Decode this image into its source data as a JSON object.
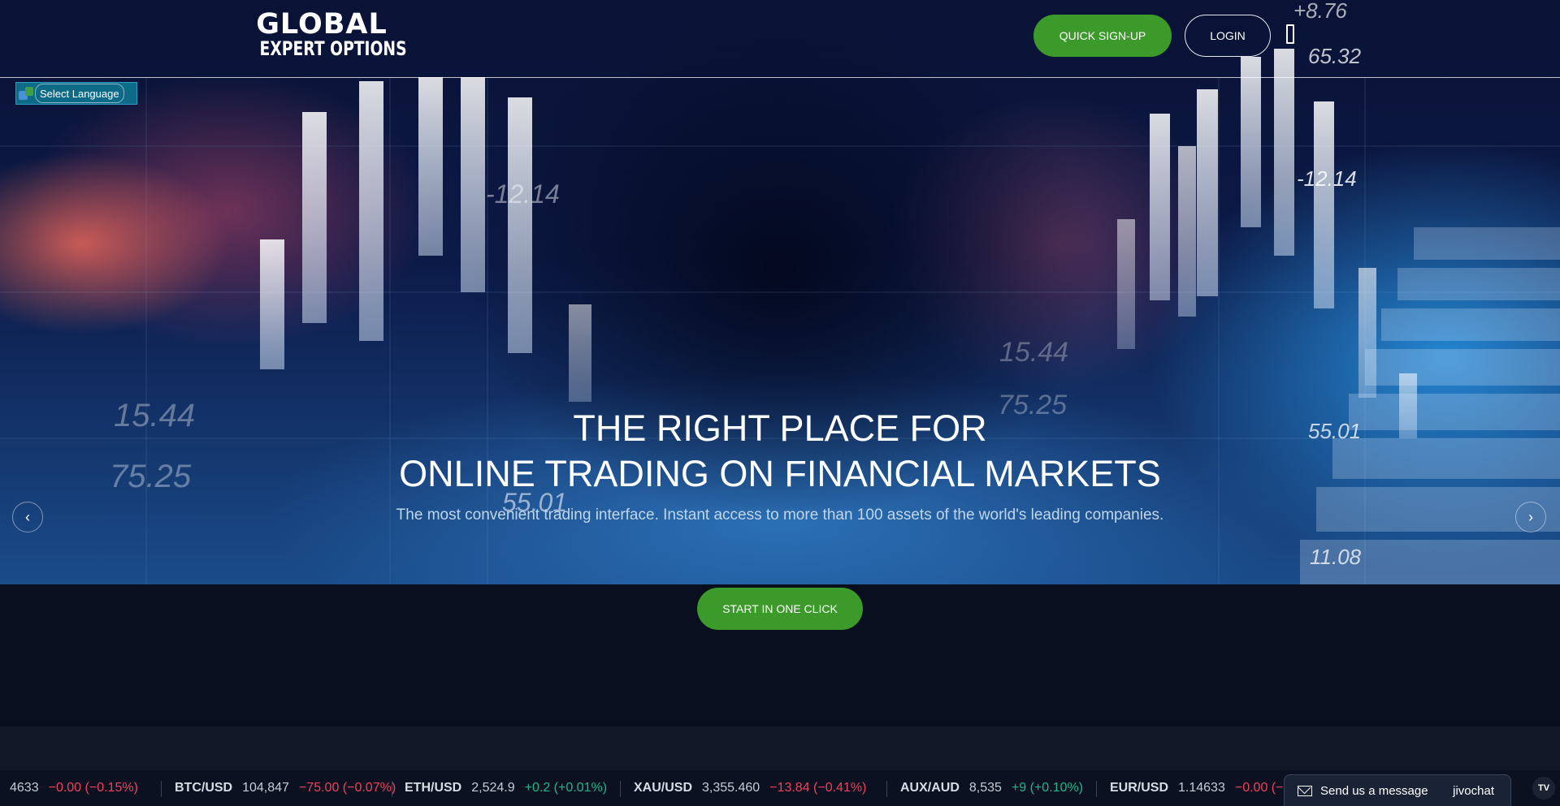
{
  "header": {
    "logo_line1": "GLOBAL",
    "logo_line2": "EXPERT OPTIONS",
    "signup_label": "QUICK SIGN-UP",
    "login_label": "LOGIN",
    "menu_icon": "menu-icon"
  },
  "language": {
    "label": "Select Language",
    "icon": "google-translate-icon"
  },
  "hero": {
    "title_line1": "THE RIGHT PLACE FOR",
    "title_line2": "ONLINE TRADING ON FINANCIAL MARKETS",
    "subtitle": "The most convenient trading interface. Instant access to more than 100 assets of the world's leading companies.",
    "prev_label": "‹",
    "next_label": "›",
    "cta_label": "START IN ONE CLICK",
    "background_numbers": [
      "-12.14",
      "15.44",
      "75.25",
      "55.01",
      "+8.76",
      "65.32",
      "-12.14",
      "15.44",
      "75.25",
      "55.01",
      "11.08"
    ]
  },
  "ticker": {
    "items": [
      {
        "symbol": "",
        "price": "4633",
        "change": "−0.00 (−0.15%)",
        "direction": "down"
      },
      {
        "symbol": "BTC/USD",
        "price": "104,847",
        "change": "−75.00 (−0.07%)",
        "direction": "down"
      },
      {
        "symbol": "ETH/USD",
        "price": "2,524.9",
        "change": "+0.2 (+0.01%)",
        "direction": "up"
      },
      {
        "symbol": "XAU/USD",
        "price": "3,355.460",
        "change": "−13.84 (−0.41%)",
        "direction": "down"
      },
      {
        "symbol": "AUX/AUD",
        "price": "8,535",
        "change": "+9 (+0.10%)",
        "direction": "up"
      },
      {
        "symbol": "EUR/USD",
        "price": "1.14633",
        "change": "−0.00 (−",
        "direction": "down"
      }
    ]
  },
  "chat": {
    "label": "Send us a message",
    "brand": "jivochat",
    "icon": "mail-icon"
  },
  "tradingview_badge": "TV",
  "colors": {
    "accent_green": "#3c9a2a",
    "negative": "#f0435a",
    "positive": "#21b58a",
    "page_bg": "#0a0f1f"
  }
}
